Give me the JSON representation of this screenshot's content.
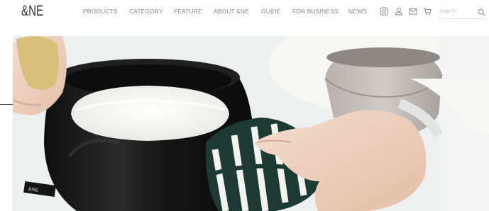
{
  "brand": {
    "logo_text": "&NE"
  },
  "nav": {
    "items": [
      {
        "label": "PRODUCTS",
        "name": "nav-products"
      },
      {
        "label": "CATEGORY",
        "name": "nav-category"
      },
      {
        "label": "FEATURE",
        "name": "nav-feature"
      },
      {
        "label": "ABOUT &NE",
        "name": "nav-about"
      },
      {
        "label": "GUIDE",
        "name": "nav-guide"
      },
      {
        "label": "FOR BUSINESS",
        "name": "nav-for-business"
      },
      {
        "label": "NEWS",
        "name": "nav-news"
      }
    ]
  },
  "header_icons": [
    "instagram-icon",
    "account-icon",
    "mail-icon",
    "cart-icon"
  ],
  "search": {
    "placeholder": "search",
    "icon": "search-icon"
  },
  "hero": {
    "description_icon": "hero-image",
    "pot_label": "&NE"
  },
  "colors": {
    "text_nav": "#888888",
    "logo": "#333333",
    "pot": "#1c1c1c",
    "rice": "#f7f7f4",
    "mitt_dark": "#1e3a35"
  }
}
